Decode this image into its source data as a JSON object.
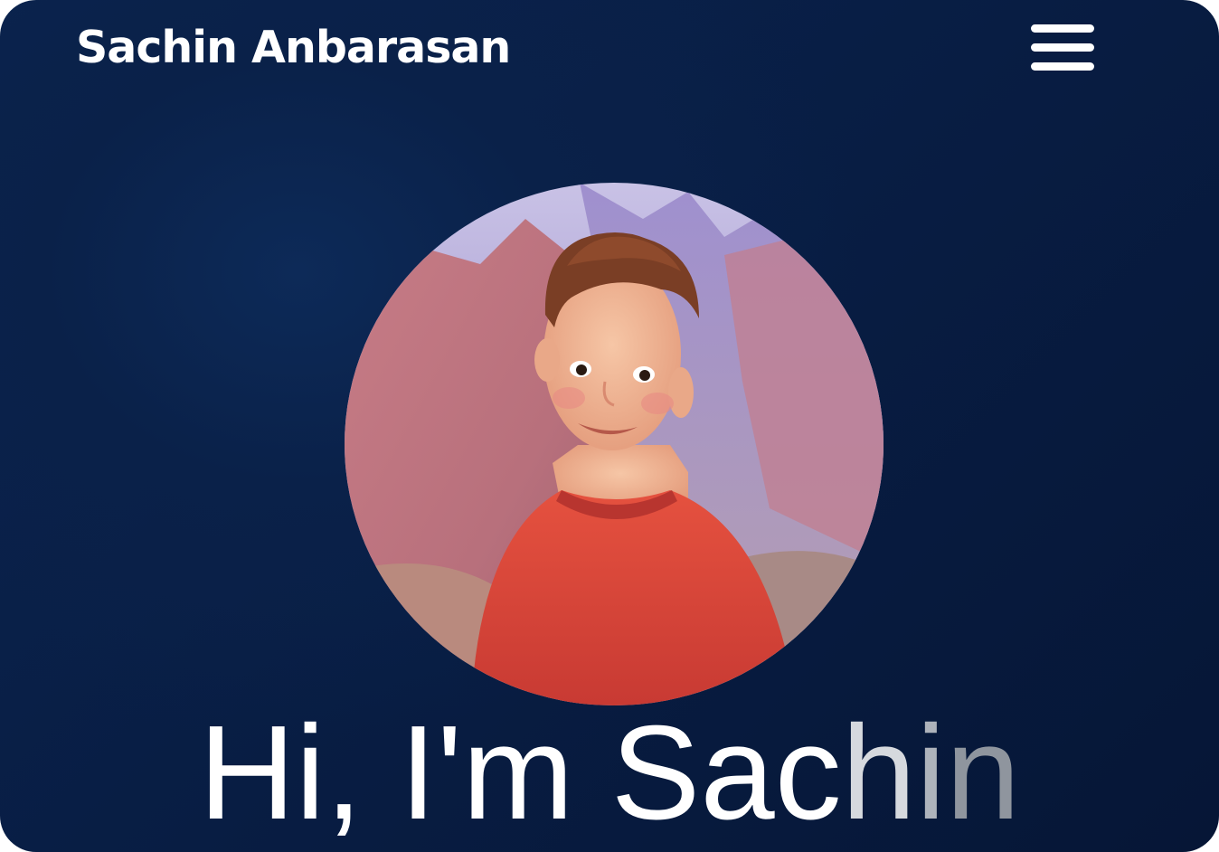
{
  "header": {
    "brand_name": "Sachin Anbarasan",
    "menu_icon": "hamburger-menu-icon"
  },
  "hero": {
    "avatar_icon": "profile-avatar-image",
    "headline_lead": "Hi, I'm Sac",
    "headline_c": "h",
    "headline_i": "i",
    "headline_n": "n"
  },
  "colors": {
    "background": "#0a2149",
    "text": "#ffffff",
    "sweater": "#d9463c"
  }
}
